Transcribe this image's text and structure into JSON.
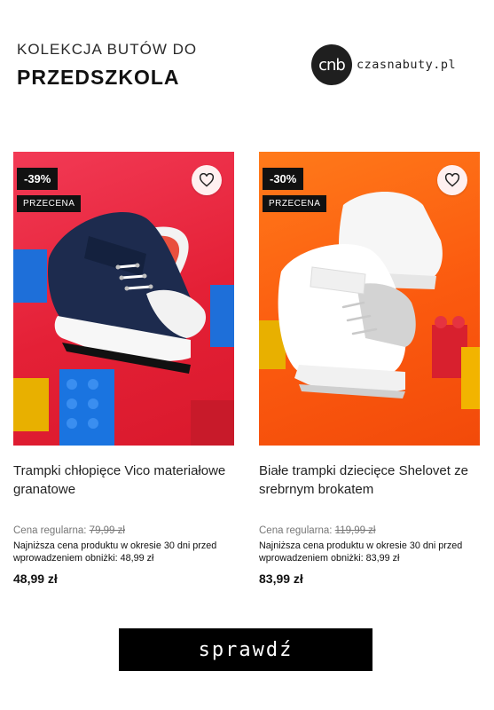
{
  "header": {
    "kicker": "KOLEKCJA BUTÓW DO",
    "headline": "PRZEDSZKOLA",
    "logo_mark": "cnb",
    "logo_text": "czasnabuty.pl"
  },
  "products": [
    {
      "discount": "-39%",
      "sale_label": "PRZECENA",
      "name": "Trampki chłopięce Vico materiałowe granatowe",
      "regular_label": "Cena regularna: ",
      "regular_price": "79,99 zł",
      "lowest_note": "Najniższa cena produktu w okresie 30 dni przed wprowadzeniem obniżki: 48,99 zł",
      "price": "48,99 zł"
    },
    {
      "discount": "-30%",
      "sale_label": "PRZECENA",
      "name": "Białe trampki dziecięce Shelovet ze srebrnym brokatem",
      "regular_label": "Cena regularna: ",
      "regular_price": "119,99 zł",
      "lowest_note": "Najniższa cena produktu w okresie 30 dni przed wprowadzeniem obniżki: 83,99 zł",
      "price": "83,99 zł"
    }
  ],
  "cta": {
    "label": "sprawdź"
  },
  "colors": {
    "left_photo_bg": "#e42036",
    "right_photo_bg": "#fb5a0f",
    "badge_bg": "#111111",
    "cta_bg": "#000000"
  }
}
